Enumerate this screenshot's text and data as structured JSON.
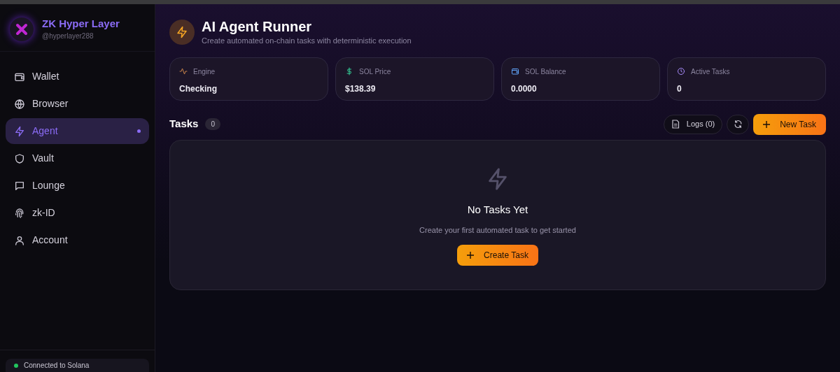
{
  "brand": {
    "name": "ZK Hyper Layer",
    "handle": "@hyperlayer288"
  },
  "nav": [
    {
      "label": "Wallet",
      "selected": false
    },
    {
      "label": "Browser",
      "selected": false
    },
    {
      "label": "Agent",
      "selected": true
    },
    {
      "label": "Vault",
      "selected": false
    },
    {
      "label": "Lounge",
      "selected": false
    },
    {
      "label": "zk-ID",
      "selected": false
    },
    {
      "label": "Account",
      "selected": false
    }
  ],
  "connection": {
    "label": "Connected to Solana"
  },
  "header": {
    "title": "AI Agent Runner",
    "subtitle": "Create automated on-chain tasks with deterministic execution"
  },
  "stats": [
    {
      "label": "Engine",
      "value": "Checking"
    },
    {
      "label": "SOL Price",
      "value": "$138.39"
    },
    {
      "label": "SOL Balance",
      "value": "0.0000"
    },
    {
      "label": "Active Tasks",
      "value": "0"
    }
  ],
  "tasks": {
    "title": "Tasks",
    "count": "0",
    "logs_button": "Logs (0)",
    "new_button": "New Task"
  },
  "empty_state": {
    "title": "No Tasks Yet",
    "message": "Create your first automated task to get started",
    "button": "Create Task"
  }
}
